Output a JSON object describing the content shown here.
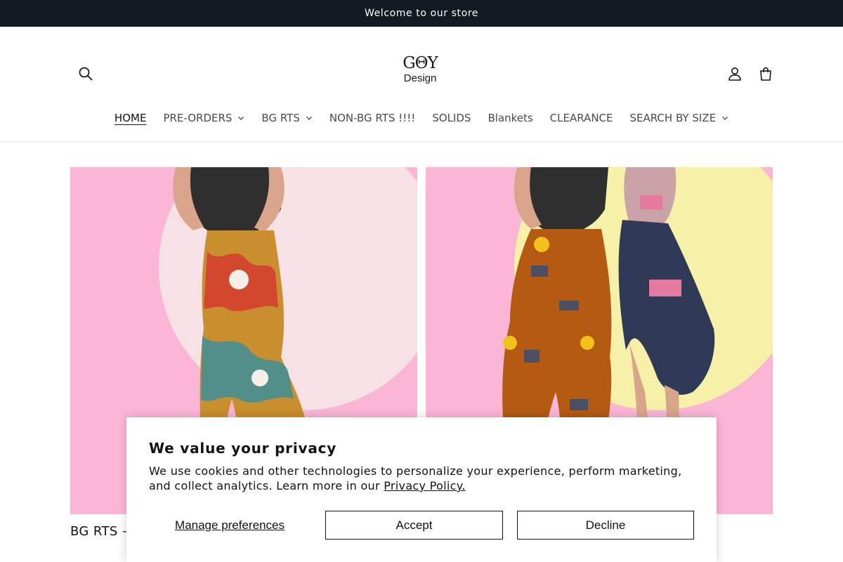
{
  "announcement": {
    "text": "Welcome to our store"
  },
  "header": {
    "logo_mark": "GΘY",
    "logo_sub": "Design",
    "icons": {
      "search": "search-icon",
      "account": "user-icon",
      "cart": "bag-icon"
    }
  },
  "nav": {
    "items": [
      {
        "label": "HOME",
        "active": true,
        "dropdown": false
      },
      {
        "label": "PRE-ORDERS",
        "active": false,
        "dropdown": true
      },
      {
        "label": "BG RTS",
        "active": false,
        "dropdown": true
      },
      {
        "label": "NON-BG RTS !!!!",
        "active": false,
        "dropdown": false
      },
      {
        "label": "SOLIDS",
        "active": false,
        "dropdown": false
      },
      {
        "label": "Blankets",
        "active": false,
        "dropdown": false
      },
      {
        "label": "CLEARANCE",
        "active": false,
        "dropdown": false
      },
      {
        "label": "SEARCH BY SIZE",
        "active": false,
        "dropdown": true
      }
    ]
  },
  "collections": [
    {
      "caption": "BG RTS –"
    },
    {
      "caption": ""
    }
  ],
  "consent": {
    "title": "We value your privacy",
    "body": "We use cookies and other technologies to personalize your experience, perform marketing, and collect analytics. Learn more in our ",
    "link": "Privacy Policy.",
    "manage_label": "Manage preferences",
    "accept_label": "Accept",
    "decline_label": "Decline"
  },
  "colors": {
    "announcement_bg": "#131a24",
    "card_bg": "#fbb6d6",
    "circle_pale": "#f6e2e4",
    "circle_yellow": "#f6f0a8"
  }
}
